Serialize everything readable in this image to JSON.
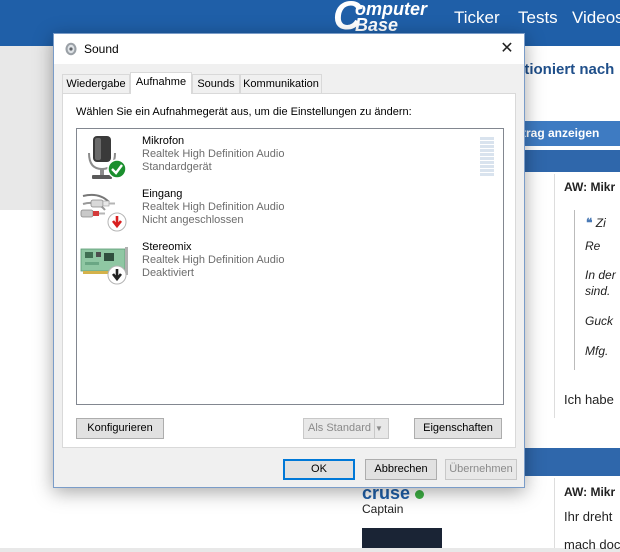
{
  "background": {
    "logo_line1": "omputer",
    "logo_big_letter": "C",
    "logo_line2": "Base",
    "nav": [
      "Ticker",
      "Tests",
      "Videos"
    ],
    "thread_title_fragment": "ktioniert nach",
    "show_button_fragment": "trag anzeigen",
    "post1_title": "AW: Mikr",
    "quote_lines": [
      "Zi",
      "Re",
      "In der",
      "sind.",
      "Guck",
      "Mfg."
    ],
    "post1_text": "Ich habe",
    "post2_title": "AW: Mikr",
    "post2_text_1": "Ihr dreht",
    "post2_text_2": "mach doc",
    "username": "cruse",
    "user_rank": "Captain"
  },
  "dialog": {
    "title": "Sound",
    "close_glyph": "✕",
    "tabs": [
      {
        "label": "Wiedergabe",
        "active": false
      },
      {
        "label": "Aufnahme",
        "active": true
      },
      {
        "label": "Sounds",
        "active": false
      },
      {
        "label": "Kommunikation",
        "active": false
      }
    ],
    "instruction": "Wählen Sie ein Aufnahmegerät aus, um die Einstellungen zu ändern:",
    "devices": [
      {
        "name": "Mikrofon",
        "driver": "Realtek High Definition Audio",
        "status": "Standardgerät",
        "icon": "microphone-icon",
        "badge": "green-check-badge"
      },
      {
        "name": "Eingang",
        "driver": "Realtek High Definition Audio",
        "status": "Nicht angeschlossen",
        "icon": "audio-cable-icon",
        "badge": "red-down-arrow-badge"
      },
      {
        "name": "Stereomix",
        "driver": "Realtek High Definition Audio",
        "status": "Deaktiviert",
        "icon": "sound-card-icon",
        "badge": "black-down-arrow-badge"
      }
    ],
    "buttons": {
      "configure": "Konfigurieren",
      "set_default": "Als Standard",
      "properties": "Eigenschaften",
      "ok": "OK",
      "cancel": "Abbrechen",
      "apply": "Übernehmen"
    },
    "colors": {
      "accent": "#0078d7",
      "disabled_text": "#8a8a8a",
      "status_text": "#6d6d6d"
    }
  }
}
